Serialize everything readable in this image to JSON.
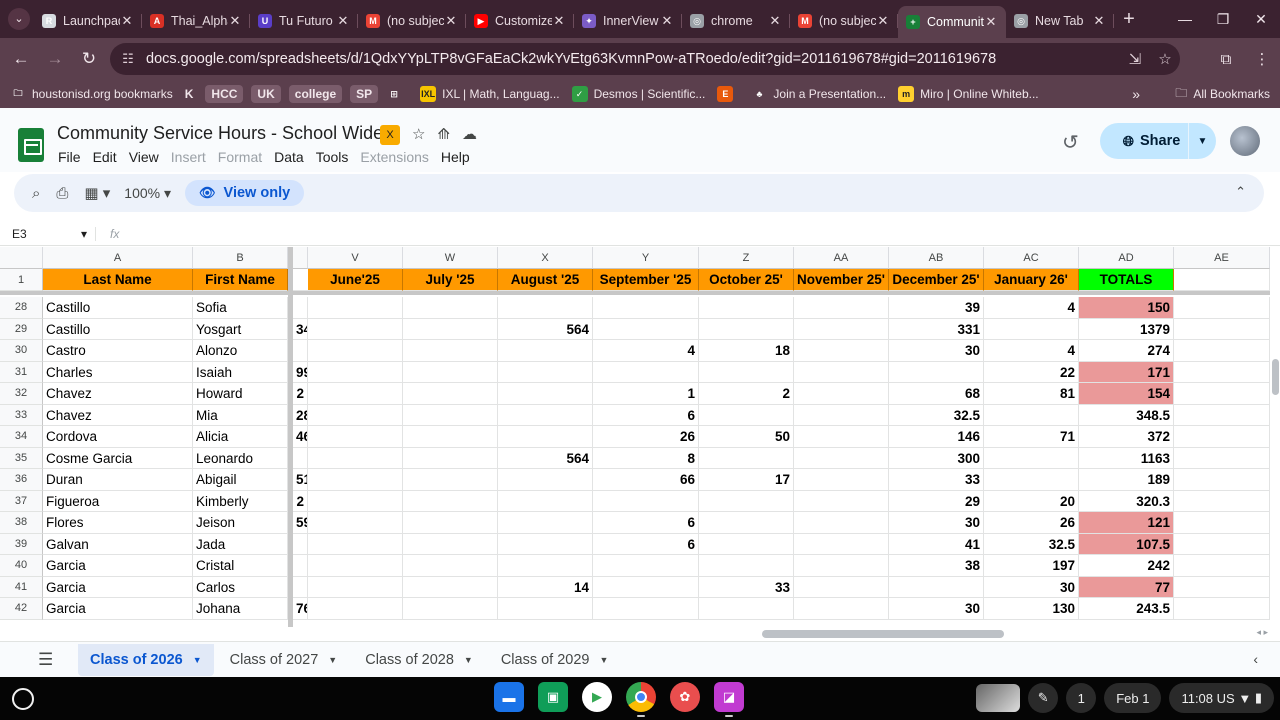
{
  "browser": {
    "tabs": [
      {
        "title": "Launchpad",
        "color": "#d7dbe0",
        "glyph": "R",
        "active": false
      },
      {
        "title": "Thai_Alphabet",
        "color": "#d93025",
        "glyph": "A",
        "active": false
      },
      {
        "title": "Tu Futuro",
        "color": "#5a3ec8",
        "glyph": "U",
        "active": false
      },
      {
        "title": "(no subject)",
        "color": "#ea4335",
        "glyph": "M",
        "active": false
      },
      {
        "title": "Customize",
        "color": "#ff0000",
        "glyph": "▶",
        "active": false
      },
      {
        "title": "InnerView",
        "color": "#7b5cc6",
        "glyph": "✦",
        "active": false
      },
      {
        "title": "chrome",
        "color": "#9aa0a6",
        "glyph": "◎",
        "active": false
      },
      {
        "title": "(no subject)",
        "color": "#ea4335",
        "glyph": "M",
        "active": false
      },
      {
        "title": "Community",
        "color": "#188038",
        "glyph": "+",
        "active": true
      },
      {
        "title": "New Tab",
        "color": "#9aa0a6",
        "glyph": "◎",
        "active": false
      }
    ],
    "url": "docs.google.com/spreadsheets/d/1QdxYYpLTP8vGFaEaCk2wkYvEtg63KvmnPow-aTRoedo/edit?gid=2011619678#gid=2011619678",
    "bookmarks": [
      {
        "label": "houstonisd.org bookmarks",
        "type": "folder"
      },
      {
        "label": "K",
        "type": "letter"
      },
      {
        "label": "HCC",
        "type": "chip"
      },
      {
        "label": "UK",
        "type": "chip"
      },
      {
        "label": "college",
        "type": "chip"
      },
      {
        "label": "SP",
        "type": "chip"
      },
      {
        "label": "",
        "type": "grid"
      },
      {
        "label": "IXL | Math, Languag...",
        "type": "ixl"
      },
      {
        "label": "Desmos | Scientific...",
        "type": "desmos"
      },
      {
        "label": "",
        "type": "edpuzzle"
      },
      {
        "label": "Join a Presentation...",
        "type": "pear"
      },
      {
        "label": "Miro | Online Whiteb...",
        "type": "miro"
      }
    ],
    "all_bookmarks": "All Bookmarks"
  },
  "sheet": {
    "title": "Community Service Hours - School Wide",
    "menus": [
      {
        "label": "File",
        "disabled": false
      },
      {
        "label": "Edit",
        "disabled": false
      },
      {
        "label": "View",
        "disabled": false
      },
      {
        "label": "Insert",
        "disabled": true
      },
      {
        "label": "Format",
        "disabled": true
      },
      {
        "label": "Data",
        "disabled": false
      },
      {
        "label": "Tools",
        "disabled": false
      },
      {
        "label": "Extensions",
        "disabled": true
      },
      {
        "label": "Help",
        "disabled": false
      }
    ],
    "share_label": "Share",
    "zoom": "100%",
    "view_only": "View only",
    "name_box": "E3",
    "fx": "fx",
    "col_letters": [
      "A",
      "B",
      "V",
      "W",
      "X",
      "Y",
      "Z",
      "AA",
      "AB",
      "AC",
      "AD",
      "AE"
    ],
    "headers": [
      "Last Name",
      "First Name",
      "June'25",
      "July '25",
      "August '25",
      "September '25",
      "October 25'",
      "November 25'",
      "December 25'",
      "January 26'",
      "TOTALS"
    ],
    "rows": [
      {
        "n": "28",
        "last": "Castillo",
        "first": "Sofia",
        "u": "",
        "v": "",
        "w": "",
        "x": "",
        "y": "",
        "z": "",
        "aa": "",
        "ab": "39",
        "ac": "4",
        "ad": "150",
        "pink": true
      },
      {
        "n": "29",
        "last": "Castillo",
        "first": "Yosgart",
        "u": "34",
        "v": "",
        "w": "",
        "x": "564",
        "y": "",
        "z": "",
        "aa": "",
        "ab": "331",
        "ac": "",
        "ad": "1379",
        "pink": false
      },
      {
        "n": "30",
        "last": "Castro",
        "first": "Alonzo",
        "u": "",
        "v": "",
        "w": "",
        "x": "",
        "y": "4",
        "z": "18",
        "aa": "",
        "ab": "30",
        "ac": "4",
        "ad": "274",
        "pink": false
      },
      {
        "n": "31",
        "last": "Charles",
        "first": "Isaiah",
        "u": "99",
        "v": "",
        "w": "",
        "x": "",
        "y": "",
        "z": "",
        "aa": "",
        "ab": "",
        "ac": "22",
        "ad": "171",
        "pink": true
      },
      {
        "n": "32",
        "last": "Chavez",
        "first": "Howard",
        "u": "2",
        "v": "",
        "w": "",
        "x": "",
        "y": "1",
        "z": "2",
        "aa": "",
        "ab": "68",
        "ac": "81",
        "ad": "154",
        "pink": true
      },
      {
        "n": "33",
        "last": "Chavez",
        "first": "Mia",
        "u": "28",
        "v": "",
        "w": "",
        "x": "",
        "y": "6",
        "z": "",
        "aa": "",
        "ab": "32.5",
        "ac": "",
        "ad": "348.5",
        "pink": false
      },
      {
        "n": "34",
        "last": "Cordova",
        "first": "Alicia",
        "u": "46",
        "v": "",
        "w": "",
        "x": "",
        "y": "26",
        "z": "50",
        "aa": "",
        "ab": "146",
        "ac": "71",
        "ad": "372",
        "pink": false
      },
      {
        "n": "35",
        "last": "Cosme Garcia",
        "first": "Leonardo",
        "u": "",
        "v": "",
        "w": "",
        "x": "564",
        "y": "8",
        "z": "",
        "aa": "",
        "ab": "300",
        "ac": "",
        "ad": "1163",
        "pink": false
      },
      {
        "n": "36",
        "last": "Duran",
        "first": "Abigail",
        "u": "51",
        "v": "",
        "w": "",
        "x": "",
        "y": "66",
        "z": "17",
        "aa": "",
        "ab": "33",
        "ac": "",
        "ad": "189",
        "pink": false
      },
      {
        "n": "37",
        "last": "Figueroa",
        "first": "Kimberly",
        "u": "2",
        "v": "",
        "w": "",
        "x": "",
        "y": "",
        "z": "",
        "aa": "",
        "ab": "29",
        "ac": "20",
        "ad": "320.3",
        "pink": false
      },
      {
        "n": "38",
        "last": "Flores",
        "first": "Jeison",
        "u": "59",
        "v": "",
        "w": "",
        "x": "",
        "y": "6",
        "z": "",
        "aa": "",
        "ab": "30",
        "ac": "26",
        "ad": "121",
        "pink": true
      },
      {
        "n": "39",
        "last": "Galvan",
        "first": "Jada",
        "u": "",
        "v": "",
        "w": "",
        "x": "",
        "y": "6",
        "z": "",
        "aa": "",
        "ab": "41",
        "ac": "32.5",
        "ad": "107.5",
        "pink": true
      },
      {
        "n": "40",
        "last": "Garcia",
        "first": "Cristal",
        "u": "",
        "v": "",
        "w": "",
        "x": "",
        "y": "",
        "z": "",
        "aa": "",
        "ab": "38",
        "ac": "197",
        "ad": "242",
        "pink": false
      },
      {
        "n": "41",
        "last": "Garcia",
        "first": "Carlos",
        "u": "",
        "v": "",
        "w": "",
        "x": "14",
        "y": "",
        "z": "33",
        "aa": "",
        "ab": "",
        "ac": "30",
        "ad": "77",
        "pink": true
      },
      {
        "n": "42",
        "last": "Garcia",
        "first": "Johana",
        "u": "76",
        "v": "",
        "w": "",
        "x": "",
        "y": "",
        "z": "",
        "aa": "",
        "ab": "30",
        "ac": "130",
        "ad": "243.5",
        "pink": false
      }
    ],
    "row1_label": "1",
    "tabs": [
      {
        "label": "Class of 2026",
        "active": true
      },
      {
        "label": "Class of 2027",
        "active": false
      },
      {
        "label": "Class of 2028",
        "active": false
      },
      {
        "label": "Class of 2029",
        "active": false
      }
    ]
  },
  "shelf": {
    "date": "Feb 1",
    "time": "11:08",
    "region": "US",
    "notifications": "1"
  },
  "colors": {
    "header_orange": "#ff9900",
    "totals_green": "#00ff00",
    "low_total_pink": "#ea9999"
  }
}
